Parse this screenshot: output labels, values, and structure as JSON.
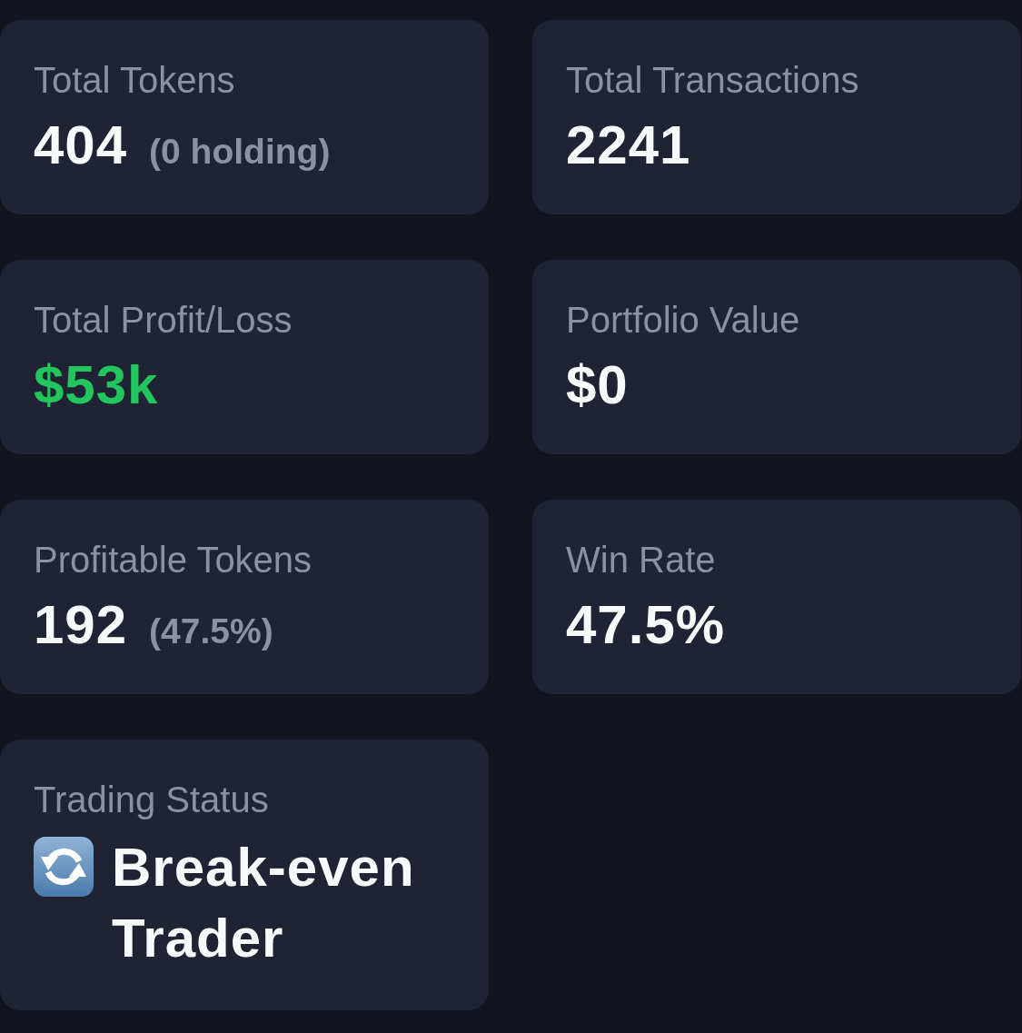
{
  "cards": [
    {
      "kind": "stat",
      "label": "Total Tokens",
      "value": "404",
      "note": "(0 holding)"
    },
    {
      "kind": "stat",
      "label": "Total Transactions",
      "value": "2241"
    },
    {
      "kind": "stat",
      "label": "Total Profit/Loss",
      "value": "$53k",
      "color": "#22c55e"
    },
    {
      "kind": "stat",
      "label": "Portfolio Value",
      "value": "$0"
    },
    {
      "kind": "stat",
      "label": "Profitable Tokens",
      "value": "192",
      "note": "(47.5%)"
    },
    {
      "kind": "stat",
      "label": "Win Rate",
      "value": "47.5%"
    },
    {
      "kind": "status",
      "label": "Trading Status",
      "value": "Break-even Trader"
    }
  ]
}
